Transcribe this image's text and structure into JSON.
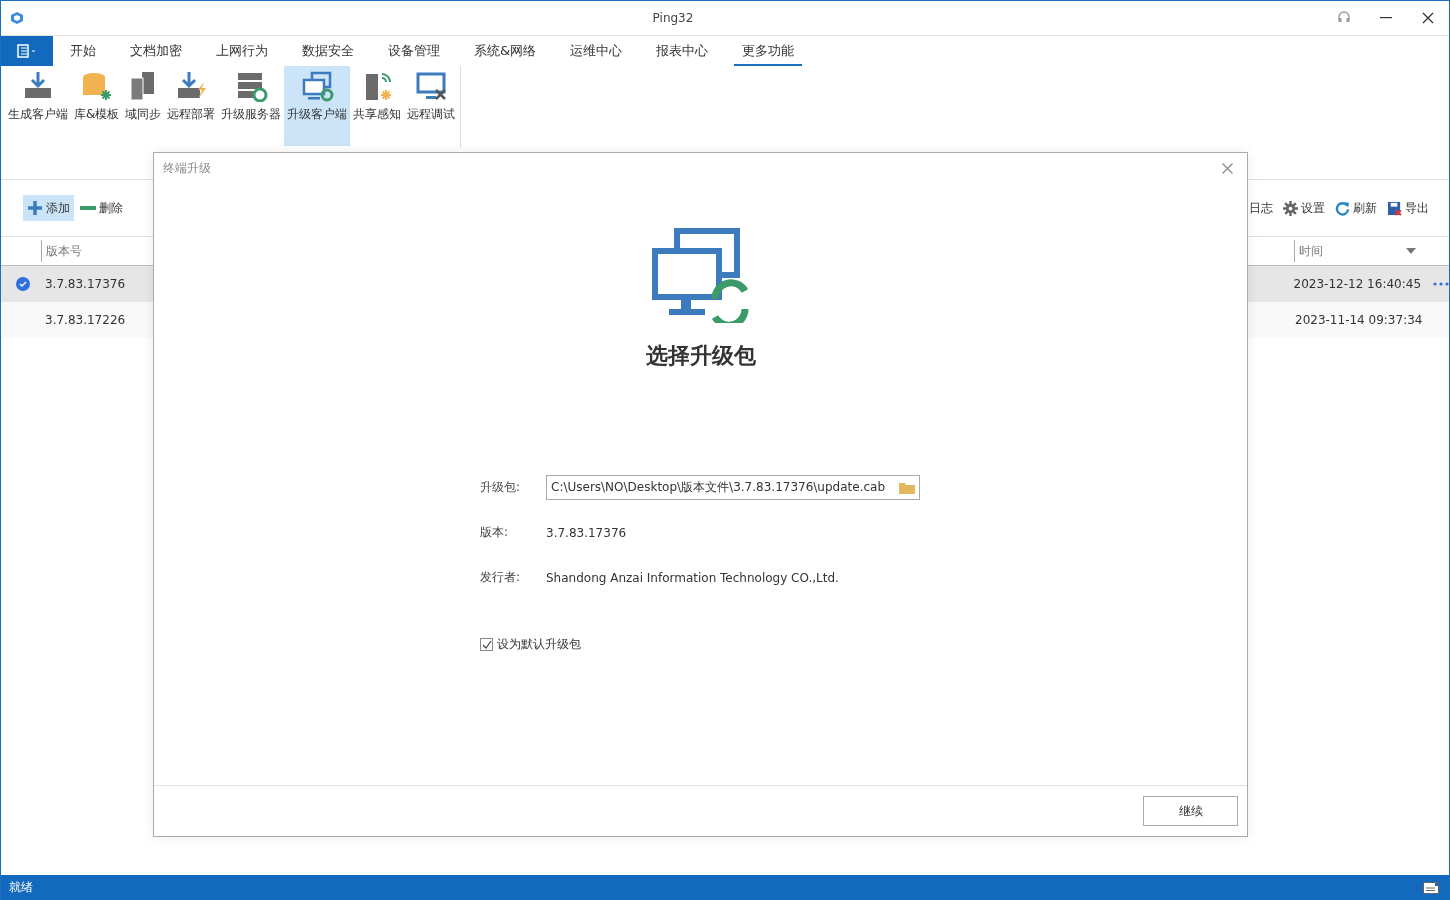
{
  "window": {
    "title": "Ping32"
  },
  "menu_tabs": [
    {
      "label": "开始",
      "selected": false
    },
    {
      "label": "文档加密",
      "selected": false
    },
    {
      "label": "上网行为",
      "selected": false
    },
    {
      "label": "数据安全",
      "selected": false
    },
    {
      "label": "设备管理",
      "selected": false
    },
    {
      "label": "系统&网络",
      "selected": false
    },
    {
      "label": "运维中心",
      "selected": false
    },
    {
      "label": "报表中心",
      "selected": false
    },
    {
      "label": "更多功能",
      "selected": true
    }
  ],
  "ribbon": [
    {
      "label": "生成客户端",
      "kind": "download",
      "selected": false
    },
    {
      "label": "库&模板",
      "kind": "database",
      "selected": false
    },
    {
      "label": "域同步",
      "kind": "servers",
      "selected": false
    },
    {
      "label": "远程部署",
      "kind": "deploy",
      "selected": false
    },
    {
      "label": "升级服务器",
      "kind": "server-sync",
      "selected": false
    },
    {
      "label": "升级客户端",
      "kind": "monitor-sync",
      "selected": true
    },
    {
      "label": "共享感知",
      "kind": "server-signal",
      "selected": false
    },
    {
      "label": "远程调试",
      "kind": "monitor-tools",
      "selected": false
    }
  ],
  "toolbar_left": [
    {
      "label": "添加",
      "kind": "add",
      "selected": true
    },
    {
      "label": "删除",
      "kind": "remove",
      "selected": false
    }
  ],
  "toolbar_right": [
    {
      "label": "日志",
      "kind": "log"
    },
    {
      "label": "设置",
      "kind": "gear"
    },
    {
      "label": "刷新",
      "kind": "refresh"
    },
    {
      "label": "导出",
      "kind": "export"
    }
  ],
  "table": {
    "columns": [
      "版本号",
      "时间"
    ],
    "rows": [
      {
        "version": "3.7.83.17376",
        "time": "2023-12-12 16:40:45",
        "selected": true
      },
      {
        "version": "3.7.83.17226",
        "time": "2023-11-14 09:37:34",
        "selected": false
      }
    ]
  },
  "dialog": {
    "title": "终端升级",
    "heading": "选择升级包",
    "fields": [
      {
        "label": "升级包:",
        "kind": "file",
        "value": "C:\\Users\\NO\\Desktop\\版本文件\\3.7.83.17376\\update.cab"
      },
      {
        "label": "版本:",
        "kind": "text",
        "value": "3.7.83.17376"
      },
      {
        "label": "发行者:",
        "kind": "text",
        "value": "Shandong Anzai Information Technology CO.,Ltd."
      }
    ],
    "checkbox": {
      "label": "设为默认升级包",
      "checked": true
    },
    "button": "继续"
  },
  "status_bar": {
    "text": "就绪"
  }
}
